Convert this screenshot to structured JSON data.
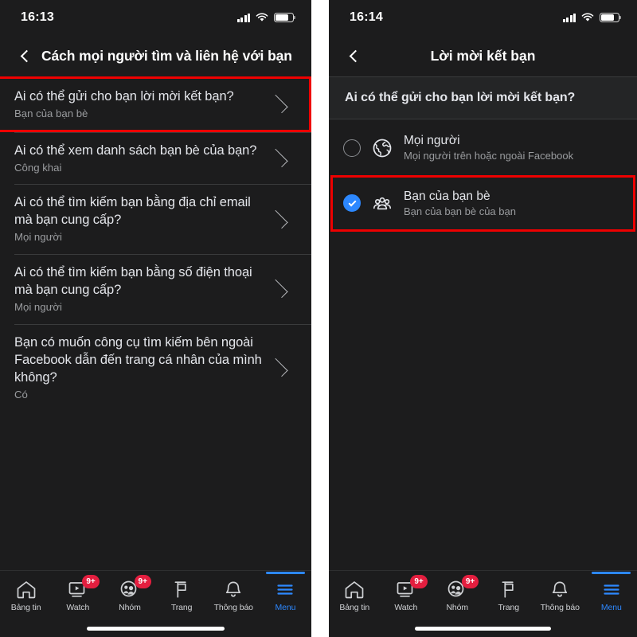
{
  "left_phone": {
    "status_bar": {
      "time": "16:13",
      "signal_icon": "cellular-bars-icon",
      "wifi_icon": "wifi-icon",
      "battery_icon": "battery-icon"
    },
    "nav": {
      "back_icon": "chevron-left-icon",
      "title": "Cách mọi người tìm và liên hệ với bạn"
    },
    "list": [
      {
        "title": "Ai có thể gửi cho bạn lời mời kết bạn?",
        "value": "Bạn của bạn bè",
        "chevron": "chevron-right-icon",
        "highlighted": true
      },
      {
        "title": "Ai có thể xem danh sách bạn bè của bạn?",
        "value": "Công khai",
        "chevron": "chevron-right-icon",
        "highlighted": false
      },
      {
        "title": "Ai có thể tìm kiếm bạn bằng địa chỉ email mà bạn cung cấp?",
        "value": "Mọi người",
        "chevron": "chevron-right-icon",
        "highlighted": false
      },
      {
        "title": "Ai có thể tìm kiếm bạn bằng số điện thoại mà bạn cung cấp?",
        "value": "Mọi người",
        "chevron": "chevron-right-icon",
        "highlighted": false
      },
      {
        "title": "Bạn có muốn công cụ tìm kiếm bên ngoài Facebook dẫn đến trang cá nhân của mình không?",
        "value": "Có",
        "chevron": "chevron-right-icon",
        "highlighted": false
      }
    ],
    "tabbar": [
      {
        "label": "Bảng tin",
        "icon": "home-icon",
        "badge": "",
        "active": false
      },
      {
        "label": "Watch",
        "icon": "watch-video-icon",
        "badge": "9+",
        "active": false
      },
      {
        "label": "Nhóm",
        "icon": "groups-icon",
        "badge": "9+",
        "active": false
      },
      {
        "label": "Trang",
        "icon": "flag-pages-icon",
        "badge": "",
        "active": false
      },
      {
        "label": "Thông báo",
        "icon": "bell-icon",
        "badge": "",
        "active": false
      },
      {
        "label": "Menu",
        "icon": "hamburger-menu-icon",
        "badge": "",
        "active": true
      }
    ]
  },
  "right_phone": {
    "status_bar": {
      "time": "16:14",
      "signal_icon": "cellular-bars-icon",
      "wifi_icon": "wifi-icon",
      "battery_icon": "battery-icon"
    },
    "nav": {
      "back_icon": "chevron-left-icon",
      "title": "Lời mời kết bạn"
    },
    "section_header": "Ai có thể gửi cho bạn lời mời kết bạn?",
    "options": [
      {
        "title": "Mọi người",
        "sub": "Mọi người trên hoặc ngoài Facebook",
        "icon": "globe-icon",
        "selected": false,
        "highlighted": false
      },
      {
        "title": "Bạn của bạn bè",
        "sub": "Bạn của bạn bè của bạn",
        "icon": "friends-group-icon",
        "selected": true,
        "highlighted": true
      }
    ],
    "tabbar": [
      {
        "label": "Bảng tin",
        "icon": "home-icon",
        "badge": "",
        "active": false
      },
      {
        "label": "Watch",
        "icon": "watch-video-icon",
        "badge": "9+",
        "active": false
      },
      {
        "label": "Nhóm",
        "icon": "groups-icon",
        "badge": "9+",
        "active": false
      },
      {
        "label": "Trang",
        "icon": "flag-pages-icon",
        "badge": "",
        "active": false
      },
      {
        "label": "Thông báo",
        "icon": "bell-icon",
        "badge": "",
        "active": false
      },
      {
        "label": "Menu",
        "icon": "hamburger-menu-icon",
        "badge": "",
        "active": true
      }
    ]
  },
  "colors": {
    "background": "#1c1c1d",
    "section_background": "#242526",
    "accent": "#2d88ff",
    "highlight_border": "#ee0000",
    "badge": "#e41e3f",
    "primary_text": "#e4e6eb",
    "secondary_text": "#9a9c9f"
  }
}
